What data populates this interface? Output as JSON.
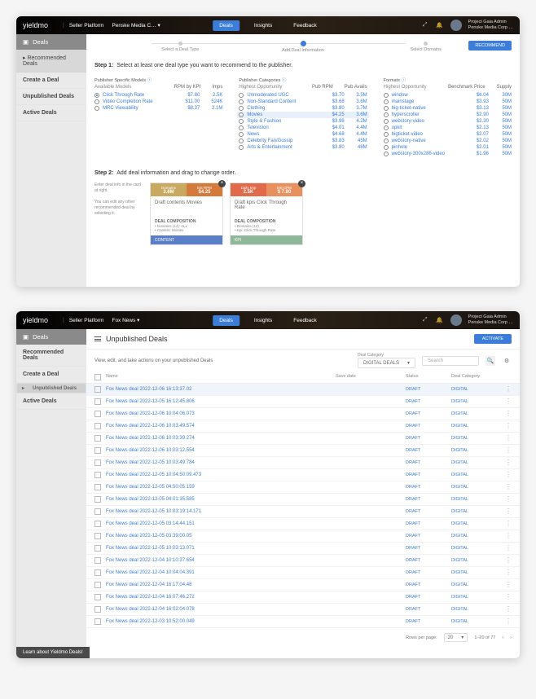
{
  "brand": "yieldmo",
  "platform": "Seller Platform",
  "nav": {
    "deals": "Deals",
    "insights": "Insights",
    "feedback": "Feedback"
  },
  "user": {
    "name": "Project Gaia Admin",
    "org": "Penske Media Corp …"
  },
  "screen1": {
    "client": "Penske Media C…",
    "sidebar": {
      "header": "Deals",
      "items": [
        "Recommended Deals",
        "Create a Deal",
        "Unpublished Deals",
        "Active Deals"
      ]
    },
    "stepper": {
      "s1": "Select a Deal Type",
      "s2": "Add Deal Information",
      "s3": "Select Domains",
      "btn": "RECOMMEND"
    },
    "step1": {
      "label": "Step 1:",
      "text": "Select at least one deal type you want to recommend to the publisher."
    },
    "col1": {
      "title": "Publisher Specific Models",
      "sub": "Available Models",
      "h1": "RPM by KPI",
      "h2": "Imps",
      "rows": [
        {
          "n": "Click Through Rate",
          "a": "$7.80",
          "b": "2.5K",
          "chk": true
        },
        {
          "n": "Video Completion Rate",
          "a": "$11.00",
          "b": "524K"
        },
        {
          "n": "MRC Viewability",
          "a": "$8.37",
          "b": "2.1M"
        }
      ]
    },
    "col2": {
      "title": "Publisher Categories",
      "sub": "Highest Opportunity",
      "h1": "Pub RPM",
      "h2": "Pub Avails",
      "rows": [
        {
          "n": "Unmoderated UGC",
          "a": "$3.70",
          "b": "3.5M"
        },
        {
          "n": "Non-Standard Content",
          "a": "$3.68",
          "b": "3.6M"
        },
        {
          "n": "Clothing",
          "a": "$3.80",
          "b": "3.7M"
        },
        {
          "n": "Movies",
          "a": "$4.25",
          "b": "3.6M",
          "hl": true
        },
        {
          "n": "Style & Fashion",
          "a": "$3.98",
          "b": "4.2M"
        },
        {
          "n": "Television",
          "a": "$4.01",
          "b": "4.4M"
        },
        {
          "n": "News",
          "a": "$4.68",
          "b": "4.4M"
        },
        {
          "n": "Celebrity Fan/Gossip",
          "a": "$3.83",
          "b": "45M"
        },
        {
          "n": "Arts & Entertainment",
          "a": "$3.80",
          "b": "48M"
        }
      ]
    },
    "col3": {
      "title": "Formats",
      "sub": "Highest Opportunity",
      "h1": "Benchmark Price",
      "h2": "Supply",
      "rows": [
        {
          "n": "window",
          "a": "$6.04",
          "b": "30M"
        },
        {
          "n": "mainstage",
          "a": "$3.93",
          "b": "50M"
        },
        {
          "n": "big-ticket-native",
          "a": "$3.13",
          "b": "50M"
        },
        {
          "n": "hyperscroller",
          "a": "$2.90",
          "b": "50M"
        },
        {
          "n": "webstory-video",
          "a": "$2.30",
          "b": "50M"
        },
        {
          "n": "opkit",
          "a": "$2.13",
          "b": "50M"
        },
        {
          "n": "bigticket-video",
          "a": "$2.07",
          "b": "50M"
        },
        {
          "n": "webstory-native",
          "a": "$2.02",
          "b": "50M"
        },
        {
          "n": "pinhole",
          "a": "$2.01",
          "b": "50M"
        },
        {
          "n": "webstory-300x286-video",
          "a": "$1.96",
          "b": "50M"
        }
      ]
    },
    "step2": {
      "label": "Step 2:",
      "text": "Add deal information and drag to change order."
    },
    "cardsInfo": {
      "p1": "Enter deal info in the card at right.",
      "p2": "You can edit any other recommended deal by selecting it."
    },
    "card1": {
      "m1l": "Domains",
      "m1v": "3.6M",
      "m2l": "Est RPM",
      "m2v": "$4.25",
      "title": "Draft contents Movies",
      "compTitle": "DEAL COMPOSITION",
      "comp": [
        "Domains (14): ALL",
        "Content: Movies"
      ],
      "foot": "CONTENT",
      "c1": "#c9a85f",
      "c2": "#d47a3a",
      "cf": "#5b7fc7"
    },
    "card2": {
      "m1l": "Daily Imp",
      "m1v": "2.5K",
      "m2l": "Est CPM",
      "m2v": "$ 7.80",
      "title": "Draft kpis Click Through Rate",
      "compTitle": "DEAL COMPOSITION",
      "comp": [
        "Domains (14)",
        "Kpi: Click Through Rate"
      ],
      "foot": "KPI",
      "c1": "#e06a4a",
      "c2": "#e8915f",
      "cf": "#8fb89a"
    }
  },
  "screen2": {
    "client": "Fox News",
    "sidebar": {
      "header": "Deals",
      "items": [
        "Recommended Deals",
        "Create a Deal",
        "Unpublished Deals",
        "Active Deals"
      ]
    },
    "title": "Unpublished Deals",
    "activate": "ACTIVATE",
    "sub": "View, edit, and take actions on your unpublished Deals",
    "catLabel": "Deal Category",
    "catValue": "DIGITAL DEALS",
    "search": "Search",
    "headers": {
      "name": "Name",
      "save": "Save date",
      "status": "Status",
      "cat": "Deal Category"
    },
    "statusVal": "DRAFT",
    "catVal": "DIGITAL",
    "rows": [
      "Fox News deal 2022-12-06 16:13:37.02",
      "Fox News deal 2022-12-05 16:12:45.806",
      "Fox News deal 2022-12-06 10:04:06.073",
      "Fox News deal 2022-12-06 10:03:49.574",
      "Fox News deal 2022-12-06 10:03:39.274",
      "Fox News deal 2022-12-06 10:03:12.554",
      "Fox News deal 2022-12-05 10:03:49.784",
      "Fox News deal 2022-12-05 10:04:50:09.473",
      "Fox News deal 2022-12-05 04:50:05.159",
      "Fox News deal 2022-12-05 04:01:35.585",
      "Fox News deal 2022-12-05 10:03:19:14.171",
      "Fox News deal 2022-12-05 03:14:44.151",
      "Fox News deal 2022-12-05 03:39:00.05",
      "Fox News deal 2022-12-05 10:03:13.071",
      "Fox News deal 2022-12-04 10:10:37.654",
      "Fox News deal 2022-12-04 10:04:04.391",
      "Fox News deal 2022-12-04 16:17:04.48",
      "Fox News deal 2022-12-04 16:07:46.272",
      "Fox News deal 2022-12-04 16:02:04.078",
      "Fox News deal 2022-12-03 10:52:00.049"
    ],
    "pager": {
      "rpp": "Rows per page:",
      "rppv": "20",
      "range": "1–20 of 77"
    },
    "learn": "Learn about Yieldmo Deals!"
  }
}
